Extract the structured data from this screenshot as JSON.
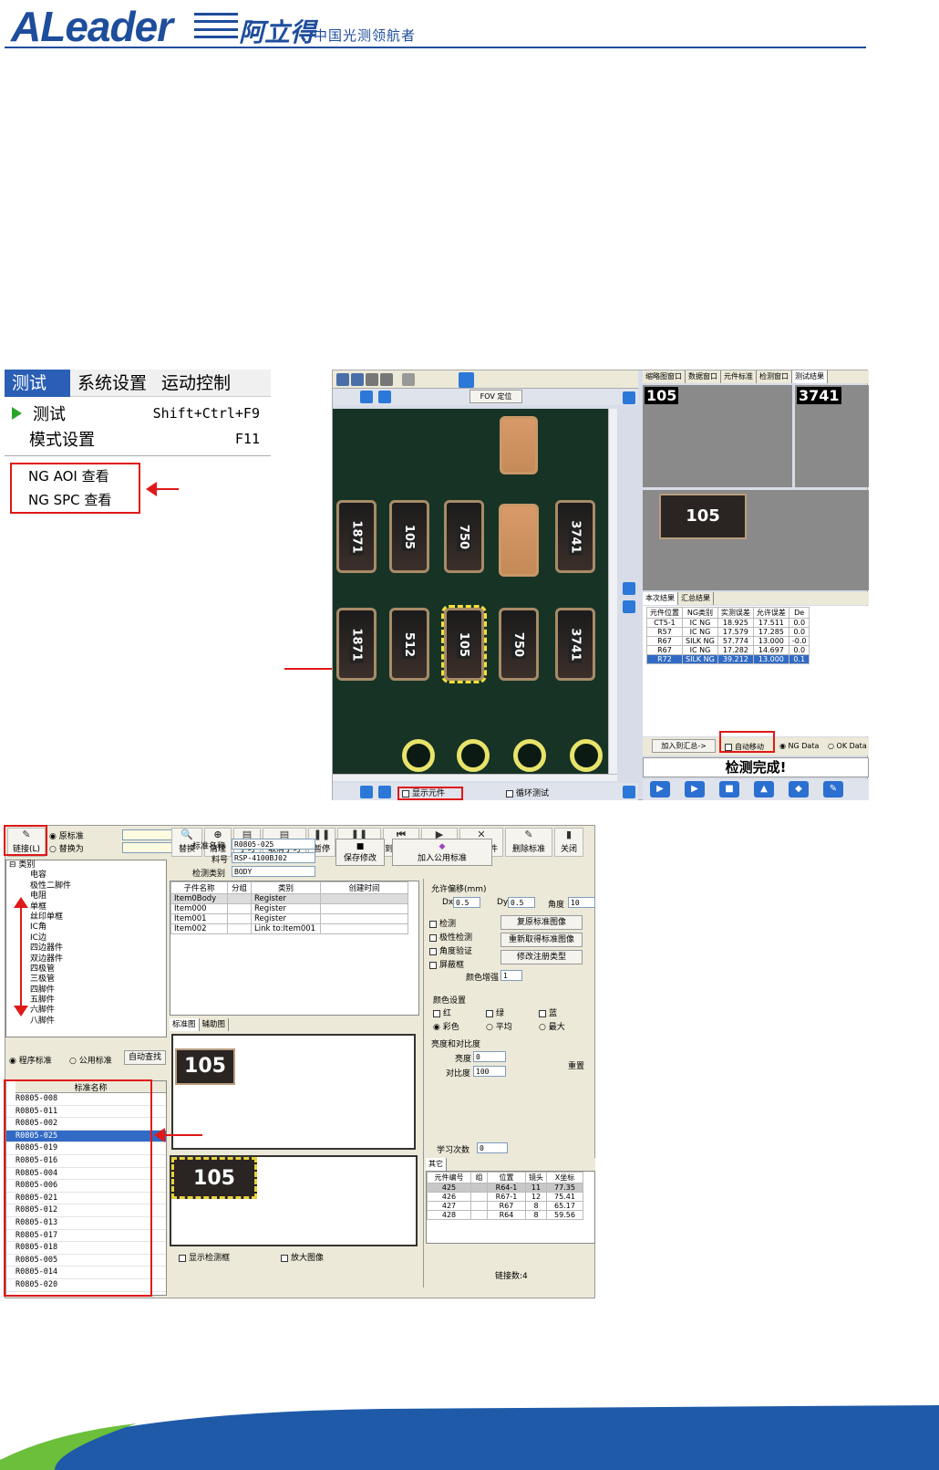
{
  "header": {
    "logo_text": "ALeader",
    "logo_cn": "阿立得",
    "tagline": "中国光测领航者"
  },
  "menu_shot": {
    "menubar": [
      "测试",
      "系统设置",
      "运动控制"
    ],
    "items": [
      {
        "label": "测试",
        "shortcut": "Shift+Ctrl+F9"
      },
      {
        "label": "模式设置",
        "shortcut": "F11"
      },
      {
        "label": "NG AOI 查看",
        "shortcut": ""
      },
      {
        "label": "NG SPC 查看",
        "shortcut": ""
      }
    ]
  },
  "inspect_shot": {
    "fov_label": "FOV 定位",
    "show_parts_label": "显示元件",
    "loop_test_label": "循环测试",
    "right_tabs": [
      "缩略图窗口",
      "数据窗口",
      "元件标准",
      "检测窗口",
      "测试结果"
    ],
    "chip_labels": [
      "105",
      "3741"
    ],
    "result_tabs": [
      "本次结果",
      "汇总结果"
    ],
    "table_headers": [
      "元件位置",
      "NG类别",
      "实测误差",
      "允许误差",
      "De"
    ],
    "rows": [
      [
        "CT5-1",
        "IC NG",
        "18.925",
        "17.511",
        "0.0"
      ],
      [
        "R57",
        "IC NG",
        "17.579",
        "17.285",
        "0.0"
      ],
      [
        "R67",
        "SILK NG",
        "57.774",
        "13.000",
        "-0.0"
      ],
      [
        "R67",
        "IC NG",
        "17.282",
        "14.697",
        "0.0"
      ],
      [
        "R72",
        "SILK NG",
        "39.212",
        "13.000",
        "0.1"
      ]
    ],
    "add_summary_label": "加入到汇总->",
    "auto_move_label": "自动移动",
    "ng_data_label": "NG Data",
    "ok_data_label": "OK Data",
    "status_text": "检测完成!",
    "pcb_chip_codes": [
      "1871",
      "105",
      "750",
      "",
      "3741",
      "1871",
      "512",
      "105",
      "750",
      "3741"
    ]
  },
  "library_shot": {
    "toolbar": [
      "链接(L)",
      "替换",
      "清理",
      "学习",
      "取消学习",
      "暂停",
      "取消暂停",
      "到第一点",
      "到下一点",
      "删除元件",
      "删除标准",
      "关闭"
    ],
    "replace_opts": [
      "原标准",
      "替换为"
    ],
    "tree_root": "类别",
    "tree_items": [
      "电容",
      "极性二脚件",
      "电阻",
      "单框",
      "丝印单框",
      "IC角",
      "IC边",
      "四边器件",
      "双边器件",
      "四极管",
      "三极管",
      "四脚件",
      "五脚件",
      "六脚件",
      "八脚件"
    ],
    "source_opts": [
      "程序标准",
      "公用标准"
    ],
    "auto_find_label": "自动查找",
    "list_header": "标准名称",
    "std_names": [
      "R0805-008",
      "R0805-011",
      "R0805-002",
      "R0805-025",
      "R0805-019",
      "R0805-016",
      "R0805-004",
      "R0805-006",
      "R0805-021",
      "R0805-012",
      "R0805-013",
      "R0805-017",
      "R0805-018",
      "R0805-005",
      "R0805-014",
      "R0805-020"
    ],
    "std_name_label": "标准名称",
    "std_name_value": "R0805-025",
    "part_no_label": "料号",
    "part_no_value": "RSP-4100BJ02",
    "type_label": "检测类别",
    "type_value": "BODY",
    "save_label": "保存修改",
    "add_public_label": "加入公用标准",
    "sub_headers": [
      "子件名称",
      "分组",
      "类别",
      "创建时间"
    ],
    "sub_rows": [
      [
        "Item0Body",
        "",
        "Register",
        ""
      ],
      [
        "Item000",
        "",
        "Register",
        ""
      ],
      [
        "Item001",
        "",
        "Register",
        ""
      ],
      [
        "Item002",
        "",
        "Link to:Item001",
        ""
      ]
    ],
    "img_tabs": [
      "标准图",
      "辅助图"
    ],
    "preview_text": "105",
    "show_box_label": "显示检测框",
    "zoom_label": "放大图像",
    "offset_title": "允许偏移(mm)",
    "dx_label": "Dx",
    "dx_value": "0.5",
    "dy_label": "Dy",
    "dy_value": "0.5",
    "angle_label": "角度",
    "angle_value": "10",
    "checks": [
      "检测",
      "极性检测",
      "角度验证",
      "屏蔽框"
    ],
    "side_buttons": [
      "复原标准图像",
      "重新取得标准图像",
      "修改注册类型"
    ],
    "color_gain_label": "颜色增强",
    "color_gain_value": "1",
    "color_title": "颜色设置",
    "rgb": [
      "红",
      "绿",
      "蓝"
    ],
    "color_modes": [
      "彩色",
      "平均",
      "最大"
    ],
    "bc_title": "亮度和对比度",
    "brightness_label": "亮度",
    "brightness_value": "0",
    "contrast_label": "对比度",
    "contrast_value": "100",
    "reset_label": "重置",
    "learn_label": "学习次数",
    "learn_value": "0",
    "other_tab": "其它",
    "ref_headers": [
      "元件编号",
      "组",
      "位置",
      "镜头",
      "X坐标"
    ],
    "ref_rows": [
      [
        "425",
        "",
        "R64-1",
        "11",
        "77.35"
      ],
      [
        "426",
        "",
        "R67-1",
        "12",
        "75.41"
      ],
      [
        "427",
        "",
        "R67",
        "8",
        "65.17"
      ],
      [
        "428",
        "",
        "R64",
        "8",
        "59.56"
      ]
    ],
    "link_count": "链接数:4"
  },
  "colors": {
    "brand": "#1e4d9c",
    "highlight": "#e01818",
    "selection": "#316ac5"
  }
}
